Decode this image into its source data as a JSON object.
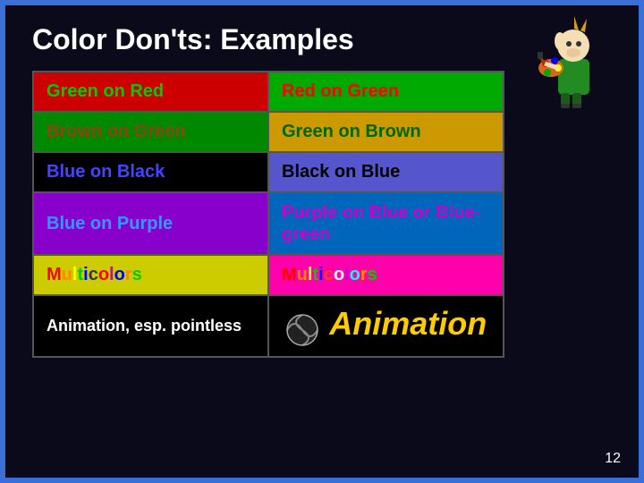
{
  "slide": {
    "title": "Color Don'ts:  Examples",
    "page_number": "12",
    "rows": [
      {
        "left_text": "Green on Red",
        "right_text": "Red on Green",
        "left_class": "green-on-red",
        "right_class": "red-on-green"
      },
      {
        "left_text": "Brown on Green",
        "right_text": "Green on Brown",
        "left_class": "brown-on-green",
        "right_class": "green-on-brown"
      },
      {
        "left_text": "Blue on Black",
        "right_text": "Black on Blue",
        "left_class": "blue-on-black",
        "right_class": "black-on-blue"
      },
      {
        "left_text": "Blue on Purple",
        "right_text": "Purple on Blue or Blue-green",
        "left_class": "blue-on-purple",
        "right_class": "purple-on-blue"
      }
    ],
    "multicolors_label": "Multicolors",
    "animation_label": "Animation, esp. pointless",
    "animation_stylized": "Animation"
  }
}
